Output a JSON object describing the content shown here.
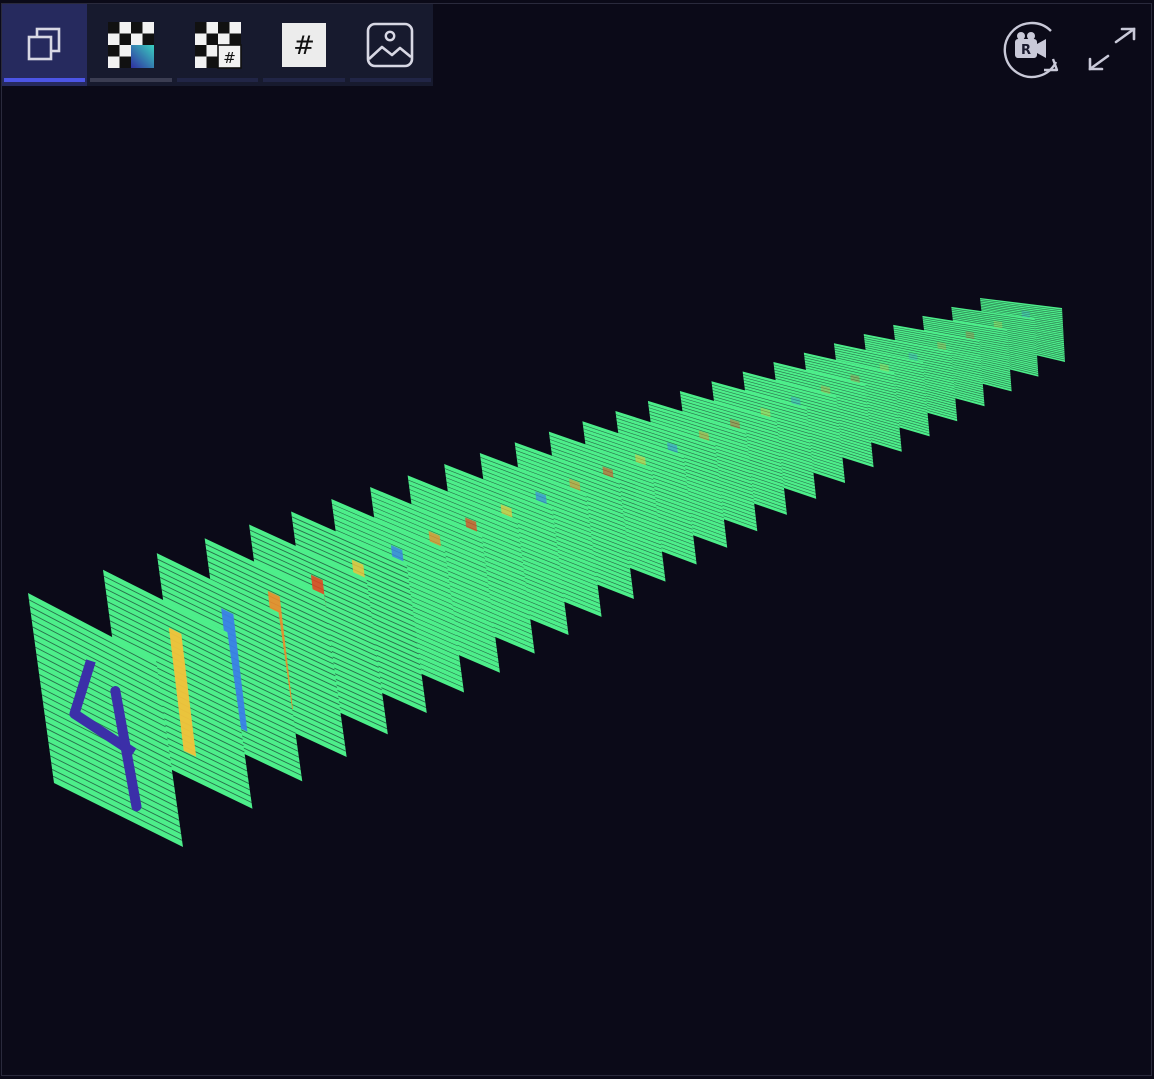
{
  "toolbar": {
    "active_index": 0,
    "items": [
      {
        "name": "layers-view-tool",
        "icon": "stacked-squares-icon"
      },
      {
        "name": "heatmap-tool",
        "icon": "checkerboard-gradient-icon"
      },
      {
        "name": "grid-values-tool",
        "icon": "checkerboard-hash-icon"
      },
      {
        "name": "number-grid-tool",
        "icon": "hash-icon",
        "glyph": "#"
      },
      {
        "name": "image-view-tool",
        "icon": "image-icon"
      }
    ]
  },
  "controls": {
    "rotate_camera": {
      "icon": "rotate-camera-icon",
      "badge": "R"
    },
    "fullscreen": {
      "icon": "expand-arrows-icon"
    }
  },
  "colors": {
    "background": "#0b0a18",
    "toolbar_bg": "#171a2e",
    "active_bg": "#262a5e",
    "active_indicator": "#4c55e6",
    "icon_stroke": "#d8d8e4",
    "neutral_activation": "#4dee8a",
    "low_activation": "#3b2fa8",
    "high_activation": "#e8401c"
  },
  "visualization": {
    "type": "feature-map-stack",
    "input_digit": "4",
    "layer_count": 27
  }
}
